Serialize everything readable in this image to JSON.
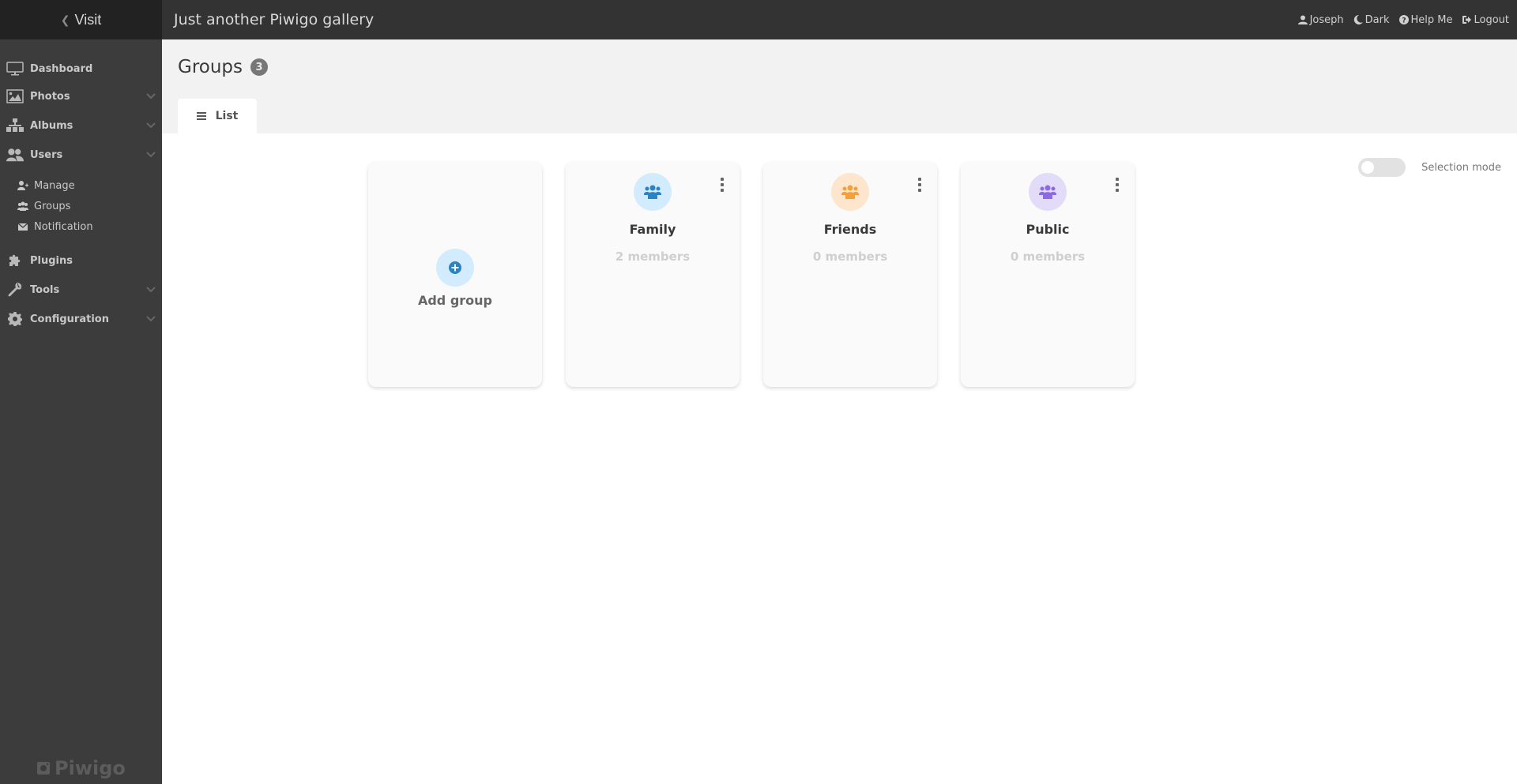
{
  "topbar": {
    "visit_label": "Visit",
    "gallery_title": "Just another Piwigo gallery",
    "actions": [
      {
        "label": "Joseph",
        "icon": "user-icon"
      },
      {
        "label": "Dark",
        "icon": "moon-icon"
      },
      {
        "label": "Help Me",
        "icon": "question-circle-icon"
      },
      {
        "label": "Logout",
        "icon": "sign-out-icon"
      }
    ]
  },
  "sidebar": {
    "items": [
      {
        "label": "Dashboard",
        "icon": "monitor-icon",
        "expandable": false
      },
      {
        "label": "Photos",
        "icon": "image-icon",
        "expandable": true
      },
      {
        "label": "Albums",
        "icon": "sitemap-icon",
        "expandable": true
      },
      {
        "label": "Users",
        "icon": "users-icon",
        "expandable": true
      },
      {
        "label": "Plugins",
        "icon": "puzzle-icon",
        "expandable": false
      },
      {
        "label": "Tools",
        "icon": "wrench-icon",
        "expandable": true
      },
      {
        "label": "Configuration",
        "icon": "gear-icon",
        "expandable": true
      }
    ],
    "users_subitems": [
      {
        "label": "Manage",
        "icon": "user-plus-icon"
      },
      {
        "label": "Groups",
        "icon": "group-icon"
      },
      {
        "label": "Notification",
        "icon": "envelope-icon"
      }
    ],
    "brand": "Piwigo"
  },
  "page": {
    "title": "Groups",
    "count": "3",
    "tabs": [
      {
        "label": "List",
        "icon": "list-icon",
        "active": true
      }
    ],
    "selection_mode_label": "Selection mode",
    "selection_mode_on": false
  },
  "groups": {
    "add_label": "Add group",
    "items": [
      {
        "name": "Family",
        "members": "2 members",
        "color": "#2a83c5",
        "bg": "#d3ecfd"
      },
      {
        "name": "Friends",
        "members": "0 members",
        "color": "#f4a13c",
        "bg": "#fde6cd"
      },
      {
        "name": "Public",
        "members": "0 members",
        "color": "#8c6ae6",
        "bg": "#e3dcf8"
      }
    ]
  }
}
